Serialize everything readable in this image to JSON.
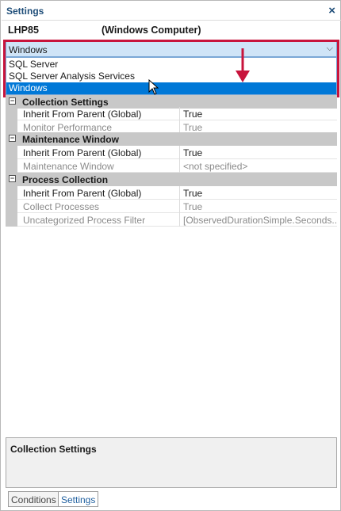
{
  "panel": {
    "title": "Settings",
    "close_glyph": "×"
  },
  "computer": {
    "name": "LHP85",
    "type": "(Windows Computer)"
  },
  "target_select": {
    "value": "Windows",
    "arrow_glyph": "⌵",
    "options": [
      "SQL Server",
      "SQL Server Analysis Services",
      "Windows"
    ],
    "selected_index": 2
  },
  "accent_colors": {
    "highlight_box": "#c8143c",
    "selected_option": "#0078d7",
    "title_text": "#1f4e79"
  },
  "categories": [
    {
      "label": "Collection Settings",
      "toggle": "−",
      "properties": [
        {
          "name": "Inherit From Parent (Global)",
          "value": "True",
          "dim": false
        },
        {
          "name": "Monitor Performance",
          "value": "True",
          "dim": true
        }
      ]
    },
    {
      "label": "Maintenance Window",
      "toggle": "−",
      "properties": [
        {
          "name": "Inherit From Parent (Global)",
          "value": "True",
          "dim": false
        },
        {
          "name": "Maintenance Window",
          "value": "<not specified>",
          "dim": true
        }
      ]
    },
    {
      "label": "Process Collection",
      "toggle": "−",
      "properties": [
        {
          "name": "Inherit From Parent (Global)",
          "value": "True",
          "dim": false
        },
        {
          "name": "Collect Processes",
          "value": "True",
          "dim": true
        },
        {
          "name": "Uncategorized Process Filter",
          "value": "[ObservedDurationSimple.Seconds...",
          "dim": true
        }
      ]
    }
  ],
  "description": {
    "title": "Collection Settings"
  },
  "tabs": [
    {
      "label": "Conditions",
      "active": false
    },
    {
      "label": "Settings",
      "active": true
    }
  ]
}
